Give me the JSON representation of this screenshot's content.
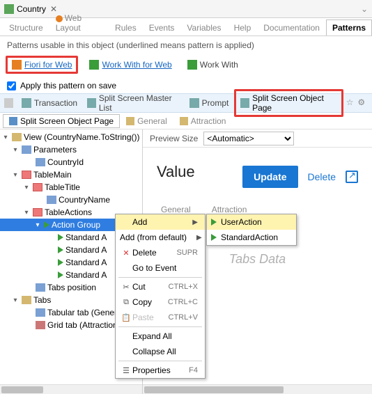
{
  "titlebar": {
    "title": "Country"
  },
  "main_tabs": [
    "Structure",
    "Web Layout",
    "Rules",
    "Events",
    "Variables",
    "Help",
    "Documentation",
    "Patterns"
  ],
  "main_tabs_active": 7,
  "hint": "Patterns usable in this object (underlined means pattern is applied)",
  "patterns": {
    "fiori": "Fiori for Web",
    "wwweb": "Work With for Web",
    "ww": "Work With"
  },
  "apply_label": "Apply this pattern on save",
  "toolbar": {
    "transaction": "Transaction",
    "split_master": "Split Screen Master List",
    "prompt": "Prompt",
    "split_object": "Split Screen Object Page"
  },
  "subtoolbar": {
    "obj_page": "Split Screen Object Page",
    "general": "General",
    "attraction": "Attraction"
  },
  "tree": {
    "view": "View (CountryName.ToString())",
    "parameters": "Parameters",
    "country_id": "CountryId",
    "table_main": "TableMain",
    "table_title": "TableTitle",
    "country_name": "CountryName",
    "table_actions": "TableActions",
    "action_group": "Action Group",
    "std_a1": "Standard A",
    "std_a2": "Standard A",
    "std_a3": "Standard A",
    "std_a4": "Standard A",
    "tabs_pos": "Tabs position",
    "tabs": "Tabs",
    "tabular": "Tabular tab (Genera",
    "grid": "Grid tab (Attraction"
  },
  "preview": {
    "size_label": "Preview Size",
    "size_value": "<Automatic>",
    "value_label": "Value",
    "update": "Update",
    "delete": "Delete",
    "tab_general": "General",
    "tab_attraction": "Attraction",
    "tabs_data": "Tabs Data"
  },
  "context_menu": {
    "add": "Add",
    "add_default": "Add (from default)",
    "delete": "Delete",
    "delete_key": "SUPR",
    "goto": "Go to Event",
    "cut": "Cut",
    "cut_key": "CTRL+X",
    "copy": "Copy",
    "copy_key": "CTRL+C",
    "paste": "Paste",
    "paste_key": "CTRL+V",
    "expand": "Expand All",
    "collapse": "Collapse All",
    "props": "Properties",
    "props_key": "F4"
  },
  "submenu": {
    "user_action": "UserAction",
    "std_action": "StandardAction"
  }
}
